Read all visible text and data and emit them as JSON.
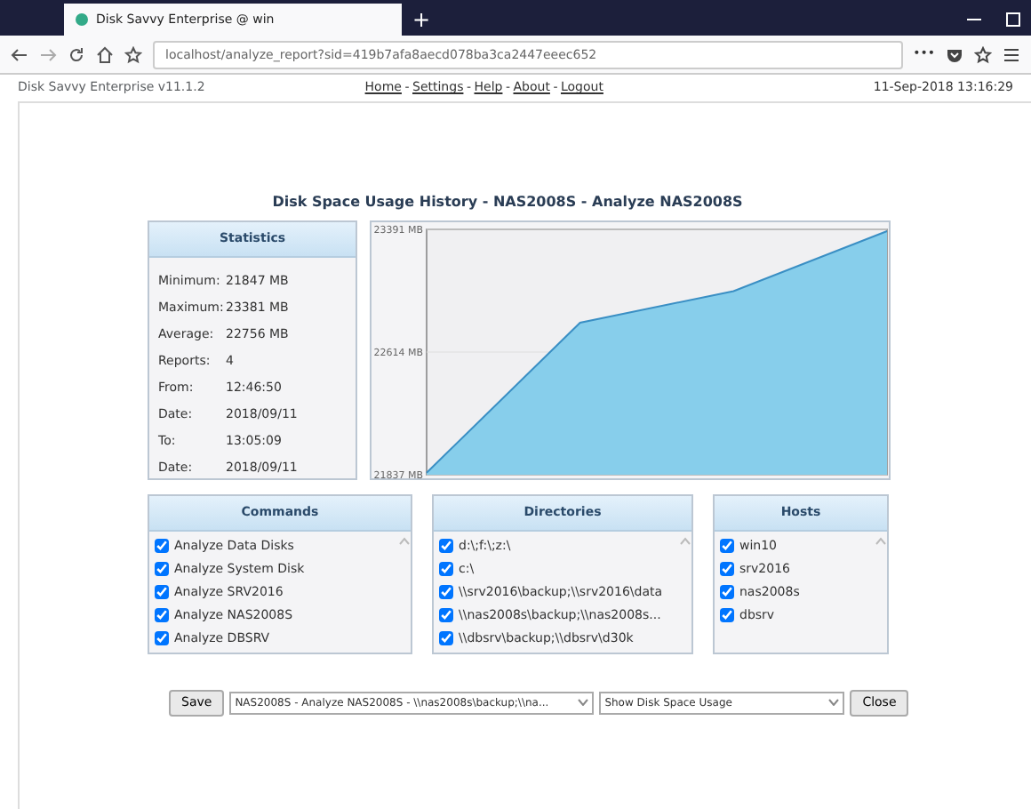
{
  "browser": {
    "tab_title": "Disk Savvy Enterprise @ win",
    "new_tab": "+",
    "url": "localhost/analyze_report?sid=419b7afa8aecd078ba3ca2447eeec652",
    "more": "•••"
  },
  "header": {
    "app_name": "Disk Savvy Enterprise v11.1.2",
    "nav": [
      "Home",
      "Settings",
      "Help",
      "About",
      "Logout"
    ],
    "separator": "-",
    "datetime": "11-Sep-2018 13:16:29"
  },
  "title": "Disk Space Usage History - NAS2008S - Analyze NAS2008S",
  "statistics": {
    "heading": "Statistics",
    "rows": [
      {
        "label": "Minimum:",
        "value": "21847 MB"
      },
      {
        "label": "Maximum:",
        "value": "23381 MB"
      },
      {
        "label": "Average:",
        "value": "22756 MB"
      },
      {
        "label": "Reports:",
        "value": "4"
      },
      {
        "label": "From:",
        "value": "12:46:50"
      },
      {
        "label": "Date:",
        "value": "2018/09/11"
      },
      {
        "label": "To:",
        "value": "13:05:09"
      },
      {
        "label": "Date:",
        "value": "2018/09/11"
      }
    ]
  },
  "chart": {
    "chart_data": {
      "type": "area",
      "series": [
        {
          "color": "#87ceeb",
          "values": [
            21850,
            22800,
            23000,
            23380
          ]
        }
      ],
      "ylim": [
        21837,
        23391
      ],
      "yticks": [
        {
          "value": 21837,
          "label": "21837 MB"
        },
        {
          "value": 22614,
          "label": "22614 MB"
        },
        {
          "value": 23391,
          "label": "23391 MB"
        }
      ]
    }
  },
  "lists": [
    {
      "heading": "Commands",
      "items": [
        {
          "label": "Analyze Data Disks",
          "checked": true
        },
        {
          "label": "Analyze System Disk",
          "checked": true
        },
        {
          "label": "Analyze SRV2016",
          "checked": true
        },
        {
          "label": "Analyze NAS2008S",
          "checked": true
        },
        {
          "label": "Analyze DBSRV",
          "checked": true
        }
      ]
    },
    {
      "heading": "Directories",
      "items": [
        {
          "label": "d:\\;f:\\;z:\\",
          "checked": true
        },
        {
          "label": "c:\\",
          "checked": true
        },
        {
          "label": "\\\\srv2016\\backup;\\\\srv2016\\data",
          "checked": true
        },
        {
          "label": "\\\\nas2008s\\backup;\\\\nas2008s...",
          "checked": true
        },
        {
          "label": "\\\\dbsrv\\backup;\\\\dbsrv\\d30k",
          "checked": true
        }
      ]
    },
    {
      "heading": "Hosts",
      "items": [
        {
          "label": "win10",
          "checked": true
        },
        {
          "label": "srv2016",
          "checked": true
        },
        {
          "label": "nas2008s",
          "checked": true
        },
        {
          "label": "dbsrv",
          "checked": true
        }
      ]
    }
  ],
  "bottom": {
    "save": "Save",
    "report_select": "NAS2008S - Analyze NAS2008S - \\\\nas2008s\\backup;\\\\na...",
    "view_select": "Show Disk Space Usage",
    "close": "Close"
  }
}
